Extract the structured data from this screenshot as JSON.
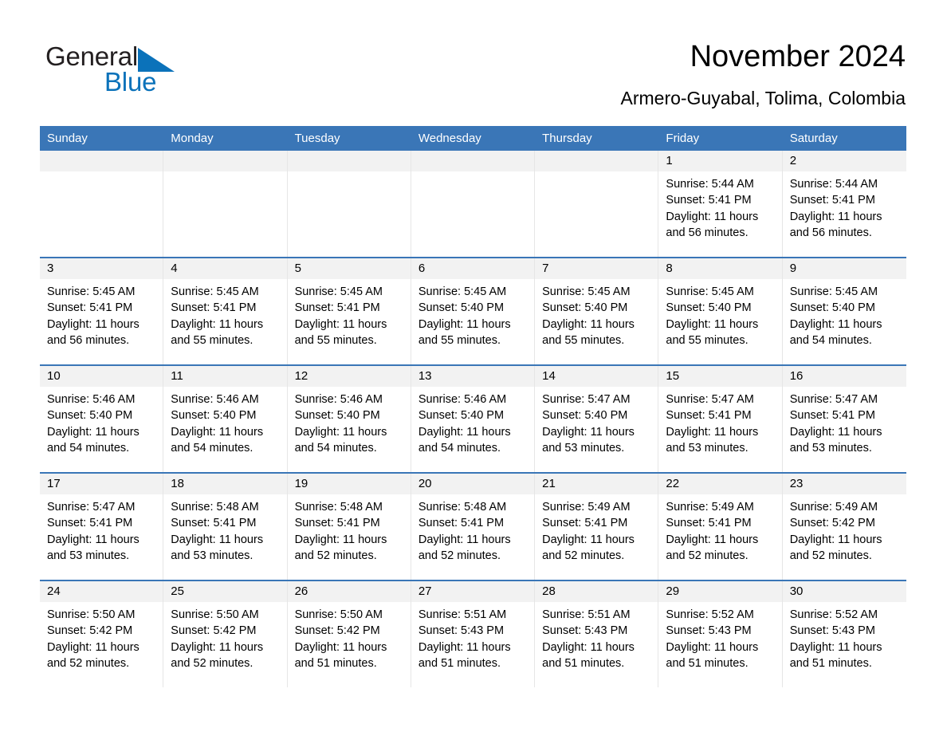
{
  "brand": {
    "name_part1": "General",
    "name_part2": "Blue",
    "triangle_icon": "blue-triangle-logo-mark",
    "accent_color": "#0b72ba"
  },
  "header": {
    "title": "November 2024",
    "location": "Armero-Guyabal, Tolima, Colombia"
  },
  "calendar": {
    "header_bg": "#3a76b7",
    "daynum_band_bg": "#f2f2f2",
    "weekdays": [
      "Sunday",
      "Monday",
      "Tuesday",
      "Wednesday",
      "Thursday",
      "Friday",
      "Saturday"
    ],
    "weeks": [
      [
        {
          "day": "",
          "lines": []
        },
        {
          "day": "",
          "lines": []
        },
        {
          "day": "",
          "lines": []
        },
        {
          "day": "",
          "lines": []
        },
        {
          "day": "",
          "lines": []
        },
        {
          "day": "1",
          "lines": [
            "Sunrise: 5:44 AM",
            "Sunset: 5:41 PM",
            "Daylight: 11 hours",
            "and 56 minutes."
          ]
        },
        {
          "day": "2",
          "lines": [
            "Sunrise: 5:44 AM",
            "Sunset: 5:41 PM",
            "Daylight: 11 hours",
            "and 56 minutes."
          ]
        }
      ],
      [
        {
          "day": "3",
          "lines": [
            "Sunrise: 5:45 AM",
            "Sunset: 5:41 PM",
            "Daylight: 11 hours",
            "and 56 minutes."
          ]
        },
        {
          "day": "4",
          "lines": [
            "Sunrise: 5:45 AM",
            "Sunset: 5:41 PM",
            "Daylight: 11 hours",
            "and 55 minutes."
          ]
        },
        {
          "day": "5",
          "lines": [
            "Sunrise: 5:45 AM",
            "Sunset: 5:41 PM",
            "Daylight: 11 hours",
            "and 55 minutes."
          ]
        },
        {
          "day": "6",
          "lines": [
            "Sunrise: 5:45 AM",
            "Sunset: 5:40 PM",
            "Daylight: 11 hours",
            "and 55 minutes."
          ]
        },
        {
          "day": "7",
          "lines": [
            "Sunrise: 5:45 AM",
            "Sunset: 5:40 PM",
            "Daylight: 11 hours",
            "and 55 minutes."
          ]
        },
        {
          "day": "8",
          "lines": [
            "Sunrise: 5:45 AM",
            "Sunset: 5:40 PM",
            "Daylight: 11 hours",
            "and 55 minutes."
          ]
        },
        {
          "day": "9",
          "lines": [
            "Sunrise: 5:45 AM",
            "Sunset: 5:40 PM",
            "Daylight: 11 hours",
            "and 54 minutes."
          ]
        }
      ],
      [
        {
          "day": "10",
          "lines": [
            "Sunrise: 5:46 AM",
            "Sunset: 5:40 PM",
            "Daylight: 11 hours",
            "and 54 minutes."
          ]
        },
        {
          "day": "11",
          "lines": [
            "Sunrise: 5:46 AM",
            "Sunset: 5:40 PM",
            "Daylight: 11 hours",
            "and 54 minutes."
          ]
        },
        {
          "day": "12",
          "lines": [
            "Sunrise: 5:46 AM",
            "Sunset: 5:40 PM",
            "Daylight: 11 hours",
            "and 54 minutes."
          ]
        },
        {
          "day": "13",
          "lines": [
            "Sunrise: 5:46 AM",
            "Sunset: 5:40 PM",
            "Daylight: 11 hours",
            "and 54 minutes."
          ]
        },
        {
          "day": "14",
          "lines": [
            "Sunrise: 5:47 AM",
            "Sunset: 5:40 PM",
            "Daylight: 11 hours",
            "and 53 minutes."
          ]
        },
        {
          "day": "15",
          "lines": [
            "Sunrise: 5:47 AM",
            "Sunset: 5:41 PM",
            "Daylight: 11 hours",
            "and 53 minutes."
          ]
        },
        {
          "day": "16",
          "lines": [
            "Sunrise: 5:47 AM",
            "Sunset: 5:41 PM",
            "Daylight: 11 hours",
            "and 53 minutes."
          ]
        }
      ],
      [
        {
          "day": "17",
          "lines": [
            "Sunrise: 5:47 AM",
            "Sunset: 5:41 PM",
            "Daylight: 11 hours",
            "and 53 minutes."
          ]
        },
        {
          "day": "18",
          "lines": [
            "Sunrise: 5:48 AM",
            "Sunset: 5:41 PM",
            "Daylight: 11 hours",
            "and 53 minutes."
          ]
        },
        {
          "day": "19",
          "lines": [
            "Sunrise: 5:48 AM",
            "Sunset: 5:41 PM",
            "Daylight: 11 hours",
            "and 52 minutes."
          ]
        },
        {
          "day": "20",
          "lines": [
            "Sunrise: 5:48 AM",
            "Sunset: 5:41 PM",
            "Daylight: 11 hours",
            "and 52 minutes."
          ]
        },
        {
          "day": "21",
          "lines": [
            "Sunrise: 5:49 AM",
            "Sunset: 5:41 PM",
            "Daylight: 11 hours",
            "and 52 minutes."
          ]
        },
        {
          "day": "22",
          "lines": [
            "Sunrise: 5:49 AM",
            "Sunset: 5:41 PM",
            "Daylight: 11 hours",
            "and 52 minutes."
          ]
        },
        {
          "day": "23",
          "lines": [
            "Sunrise: 5:49 AM",
            "Sunset: 5:42 PM",
            "Daylight: 11 hours",
            "and 52 minutes."
          ]
        }
      ],
      [
        {
          "day": "24",
          "lines": [
            "Sunrise: 5:50 AM",
            "Sunset: 5:42 PM",
            "Daylight: 11 hours",
            "and 52 minutes."
          ]
        },
        {
          "day": "25",
          "lines": [
            "Sunrise: 5:50 AM",
            "Sunset: 5:42 PM",
            "Daylight: 11 hours",
            "and 52 minutes."
          ]
        },
        {
          "day": "26",
          "lines": [
            "Sunrise: 5:50 AM",
            "Sunset: 5:42 PM",
            "Daylight: 11 hours",
            "and 51 minutes."
          ]
        },
        {
          "day": "27",
          "lines": [
            "Sunrise: 5:51 AM",
            "Sunset: 5:43 PM",
            "Daylight: 11 hours",
            "and 51 minutes."
          ]
        },
        {
          "day": "28",
          "lines": [
            "Sunrise: 5:51 AM",
            "Sunset: 5:43 PM",
            "Daylight: 11 hours",
            "and 51 minutes."
          ]
        },
        {
          "day": "29",
          "lines": [
            "Sunrise: 5:52 AM",
            "Sunset: 5:43 PM",
            "Daylight: 11 hours",
            "and 51 minutes."
          ]
        },
        {
          "day": "30",
          "lines": [
            "Sunrise: 5:52 AM",
            "Sunset: 5:43 PM",
            "Daylight: 11 hours",
            "and 51 minutes."
          ]
        }
      ]
    ]
  }
}
